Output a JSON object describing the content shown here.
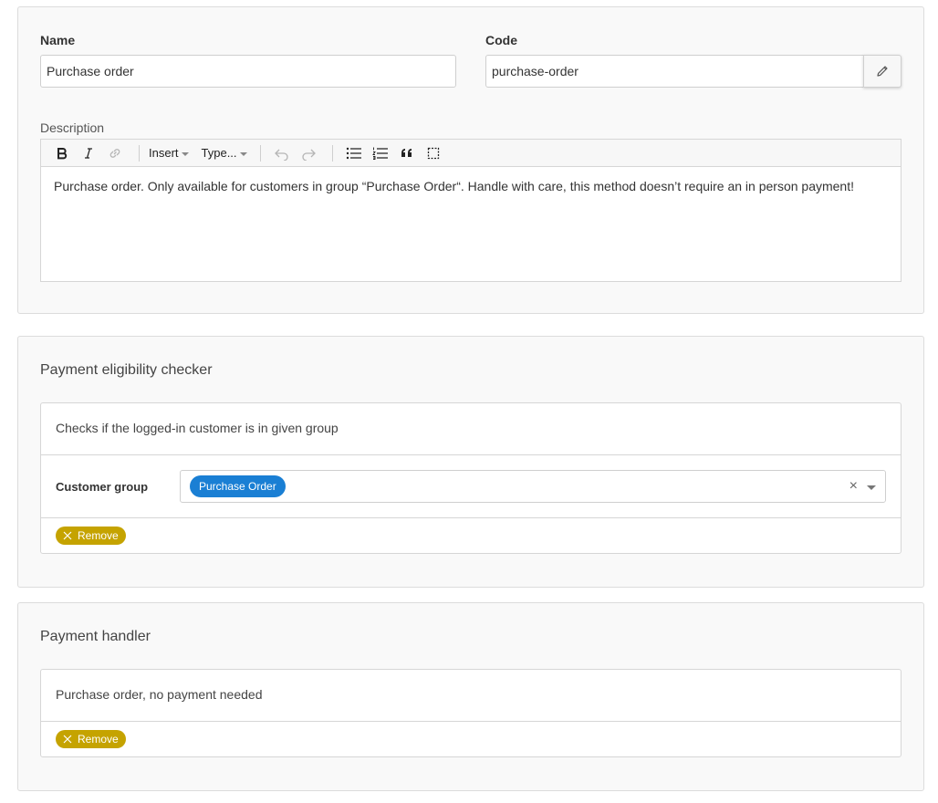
{
  "general": {
    "name_label": "Name",
    "name_value": "Purchase order",
    "code_label": "Code",
    "code_value": "purchase-order",
    "description_label": "Description",
    "toolbar": {
      "insert_label": "Insert",
      "type_label": "Type..."
    },
    "description_text": "Purchase order. Only available for customers in group “Purchase Order“. Handle with care, this method doesn’t require an in person payment!"
  },
  "eligibility": {
    "title": "Payment eligibility checker",
    "checker_description": "Checks if the logged-in customer is in given group",
    "customer_group_label": "Customer group",
    "selected_group": "Purchase Order",
    "clear_symbol": "×",
    "remove_label": "Remove"
  },
  "handler": {
    "title": "Payment handler",
    "handler_description": "Purchase order, no payment needed",
    "remove_label": "Remove"
  },
  "colors": {
    "chip_blue": "#1a7fd4",
    "remove_gold": "#c5a300",
    "card_bg": "#f9f9f9"
  }
}
